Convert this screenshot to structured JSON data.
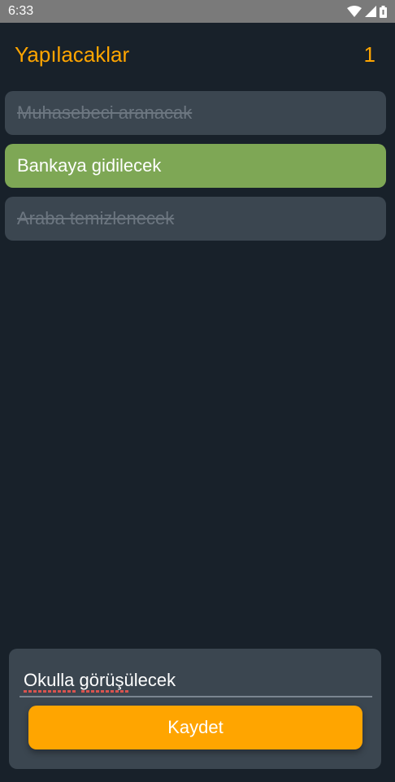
{
  "status_bar": {
    "time": "6:33",
    "icons": [
      "wifi-icon",
      "signal-icon",
      "battery-icon"
    ]
  },
  "header": {
    "title": "Yapılacaklar",
    "count": "1"
  },
  "tasks": [
    {
      "label": "Muhasebeci aranacak",
      "done": true
    },
    {
      "label": "Bankaya gidilecek",
      "done": false
    },
    {
      "label": "Araba temizlenecek",
      "done": true
    }
  ],
  "editor": {
    "input_value": "Okulla görüşülecek",
    "save_label": "Kaydet"
  },
  "colors": {
    "background": "#18212a",
    "accent": "#ffa500",
    "done_card": "#3b4650",
    "active_card": "#7ea755"
  }
}
